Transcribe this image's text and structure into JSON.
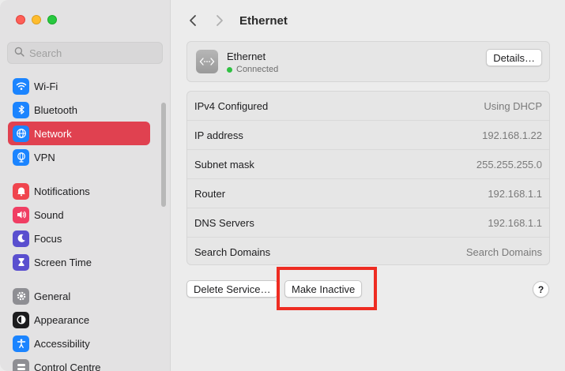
{
  "window": {
    "title": "Ethernet"
  },
  "search": {
    "placeholder": "Search"
  },
  "sidebar": {
    "groups": [
      [
        {
          "label": "Wi-Fi",
          "icon": "wifi-icon",
          "color": "#1b84ff",
          "active": false
        },
        {
          "label": "Bluetooth",
          "icon": "bluetooth-icon",
          "color": "#1b84ff",
          "active": false
        },
        {
          "label": "Network",
          "icon": "globe-icon",
          "color": "#1b84ff",
          "active": true
        },
        {
          "label": "VPN",
          "icon": "vpn-globe-icon",
          "color": "#1b84ff",
          "active": false
        }
      ],
      [
        {
          "label": "Notifications",
          "icon": "bell-icon",
          "color": "#f0454e",
          "active": false
        },
        {
          "label": "Sound",
          "icon": "speaker-icon",
          "color": "#f03e63",
          "active": false
        },
        {
          "label": "Focus",
          "icon": "moon-icon",
          "color": "#5a4fcf",
          "active": false
        },
        {
          "label": "Screen Time",
          "icon": "hourglass-icon",
          "color": "#5a4fcf",
          "active": false
        }
      ],
      [
        {
          "label": "General",
          "icon": "gear-icon",
          "color": "#8e8e93",
          "active": false
        },
        {
          "label": "Appearance",
          "icon": "appearance-icon",
          "color": "#1c1c1e",
          "active": false
        },
        {
          "label": "Accessibility",
          "icon": "accessibility-icon",
          "color": "#1b84ff",
          "active": false
        },
        {
          "label": "Control Centre",
          "icon": "control-centre-icon",
          "color": "#8e8e93",
          "active": false
        }
      ]
    ]
  },
  "header": {
    "title": "Ethernet"
  },
  "service": {
    "name": "Ethernet",
    "status": "Connected",
    "status_color": "#2fc142",
    "details_label": "Details…"
  },
  "info": {
    "rows": [
      {
        "label": "IPv4 Configured",
        "value": "Using DHCP"
      },
      {
        "label": "IP address",
        "value": "192.168.1.22"
      },
      {
        "label": "Subnet mask",
        "value": "255.255.255.0"
      },
      {
        "label": "Router",
        "value": "192.168.1.1"
      },
      {
        "label": "DNS Servers",
        "value": "192.168.1.1"
      },
      {
        "label": "Search Domains",
        "value": "Search Domains"
      }
    ]
  },
  "actions": {
    "delete_label": "Delete Service…",
    "inactive_label": "Make Inactive",
    "help_label": "?"
  },
  "colors": {
    "accent": "#e04150",
    "highlight": "#ee2c22"
  }
}
